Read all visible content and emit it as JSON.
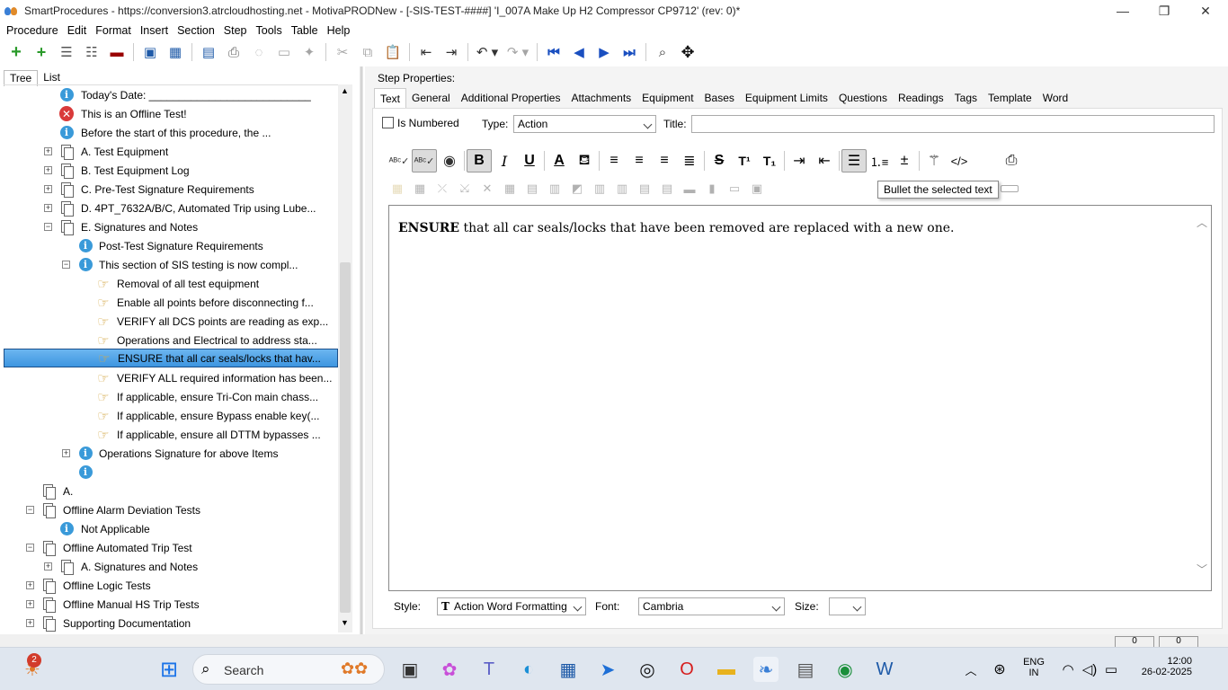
{
  "window": {
    "title": "SmartProcedures - https://conversion3.atrcloudhosting.net - MotivaPRODNew - [-SIS-TEST-####] 'I_007A Make Up H2 Compressor CP9712' (rev: 0)*",
    "minimize": "—",
    "restore": "❐",
    "close": "✕"
  },
  "menu": [
    "Procedure",
    "Edit",
    "Format",
    "Insert",
    "Section",
    "Step",
    "Tools",
    "Table",
    "Help"
  ],
  "left_tabs": {
    "tree": "Tree",
    "list": "List"
  },
  "tree": [
    {
      "label": "Today's Date: ___________________________"
    },
    {
      "label": "This is an Offline Test!"
    },
    {
      "label": "Before the start of this procedure, the ..."
    },
    {
      "label": "A. Test Equipment",
      "exp": "+"
    },
    {
      "label": "B. Test Equipment Log",
      "exp": "+"
    },
    {
      "label": "C. Pre-Test Signature Requirements",
      "exp": "+"
    },
    {
      "label": "D. 4PT_7632A/B/C, Automated Trip using Lube...",
      "exp": "+"
    },
    {
      "label": "E. Signatures and Notes",
      "exp": "−"
    },
    {
      "label": "Post-Test Signature Requirements"
    },
    {
      "label": "This section of SIS testing is now compl...",
      "exp": "−"
    },
    {
      "label": "Removal of all test equipment"
    },
    {
      "label": "Enable all points before disconnecting f..."
    },
    {
      "label": "VERIFY all DCS points are reading as exp..."
    },
    {
      "label": "Operations and Electrical to address sta..."
    },
    {
      "label": "ENSURE that all car seals/locks that hav..."
    },
    {
      "label": "VERIFY ALL required information has been..."
    },
    {
      "label": "If applicable, ensure Tri-Con main chass..."
    },
    {
      "label": "If applicable, ensure Bypass enable key(..."
    },
    {
      "label": "If applicable, ensure all DTTM bypasses ..."
    },
    {
      "label": "Operations Signature for above Items",
      "exp": "+"
    },
    {
      "label": ""
    },
    {
      "label": "A."
    },
    {
      "label": "Offline Alarm Deviation Tests",
      "exp": "−"
    },
    {
      "label": "Not Applicable"
    },
    {
      "label": "Offline Automated Trip Test",
      "exp": "−"
    },
    {
      "label": "A. Signatures and Notes",
      "exp": "+"
    },
    {
      "label": "Offline Logic Tests",
      "exp": "+"
    },
    {
      "label": "Offline Manual HS Trip Tests",
      "exp": "+"
    },
    {
      "label": "Supporting Documentation",
      "exp": "+"
    }
  ],
  "step_properties": {
    "heading": "Step Properties:",
    "tabs": [
      "Text",
      "General",
      "Additional Properties",
      "Attachments",
      "Equipment",
      "Bases",
      "Equipment Limits",
      "Questions",
      "Readings",
      "Tags",
      "Template",
      "Word"
    ],
    "is_numbered_label": "Is Numbered",
    "type_label": "Type:",
    "type_value": "Action",
    "title_label": "Title:",
    "title_value": ""
  },
  "format_toolbar": {
    "tooltip": "Bullet the selected text",
    "bold": "B",
    "italic": "I",
    "underline": "U",
    "strike": "S",
    "superscript": "T¹",
    "subscript": "T₁",
    "code": "</>"
  },
  "editor": {
    "bold_word": "ENSURE",
    "rest": " that all car seals/locks that have been removed are replaced with a new one."
  },
  "bottom": {
    "style_label": "Style:",
    "style_value": "Action Word Formatting",
    "font_label": "Font:",
    "font_value": "Cambria",
    "size_label": "Size:",
    "size_value": ""
  },
  "status": {
    "box1": "0",
    "box2": "0"
  },
  "taskbar": {
    "notification_count": "2",
    "search_label": "Search",
    "lang_line1": "ENG",
    "lang_line2": "IN",
    "time": "12:00",
    "date": "26-02-2025"
  },
  "colors": {
    "selection": "#3d95e0",
    "info": "#3a9ad9",
    "error": "#d93a3a",
    "nav_blue": "#1a4fc0"
  }
}
